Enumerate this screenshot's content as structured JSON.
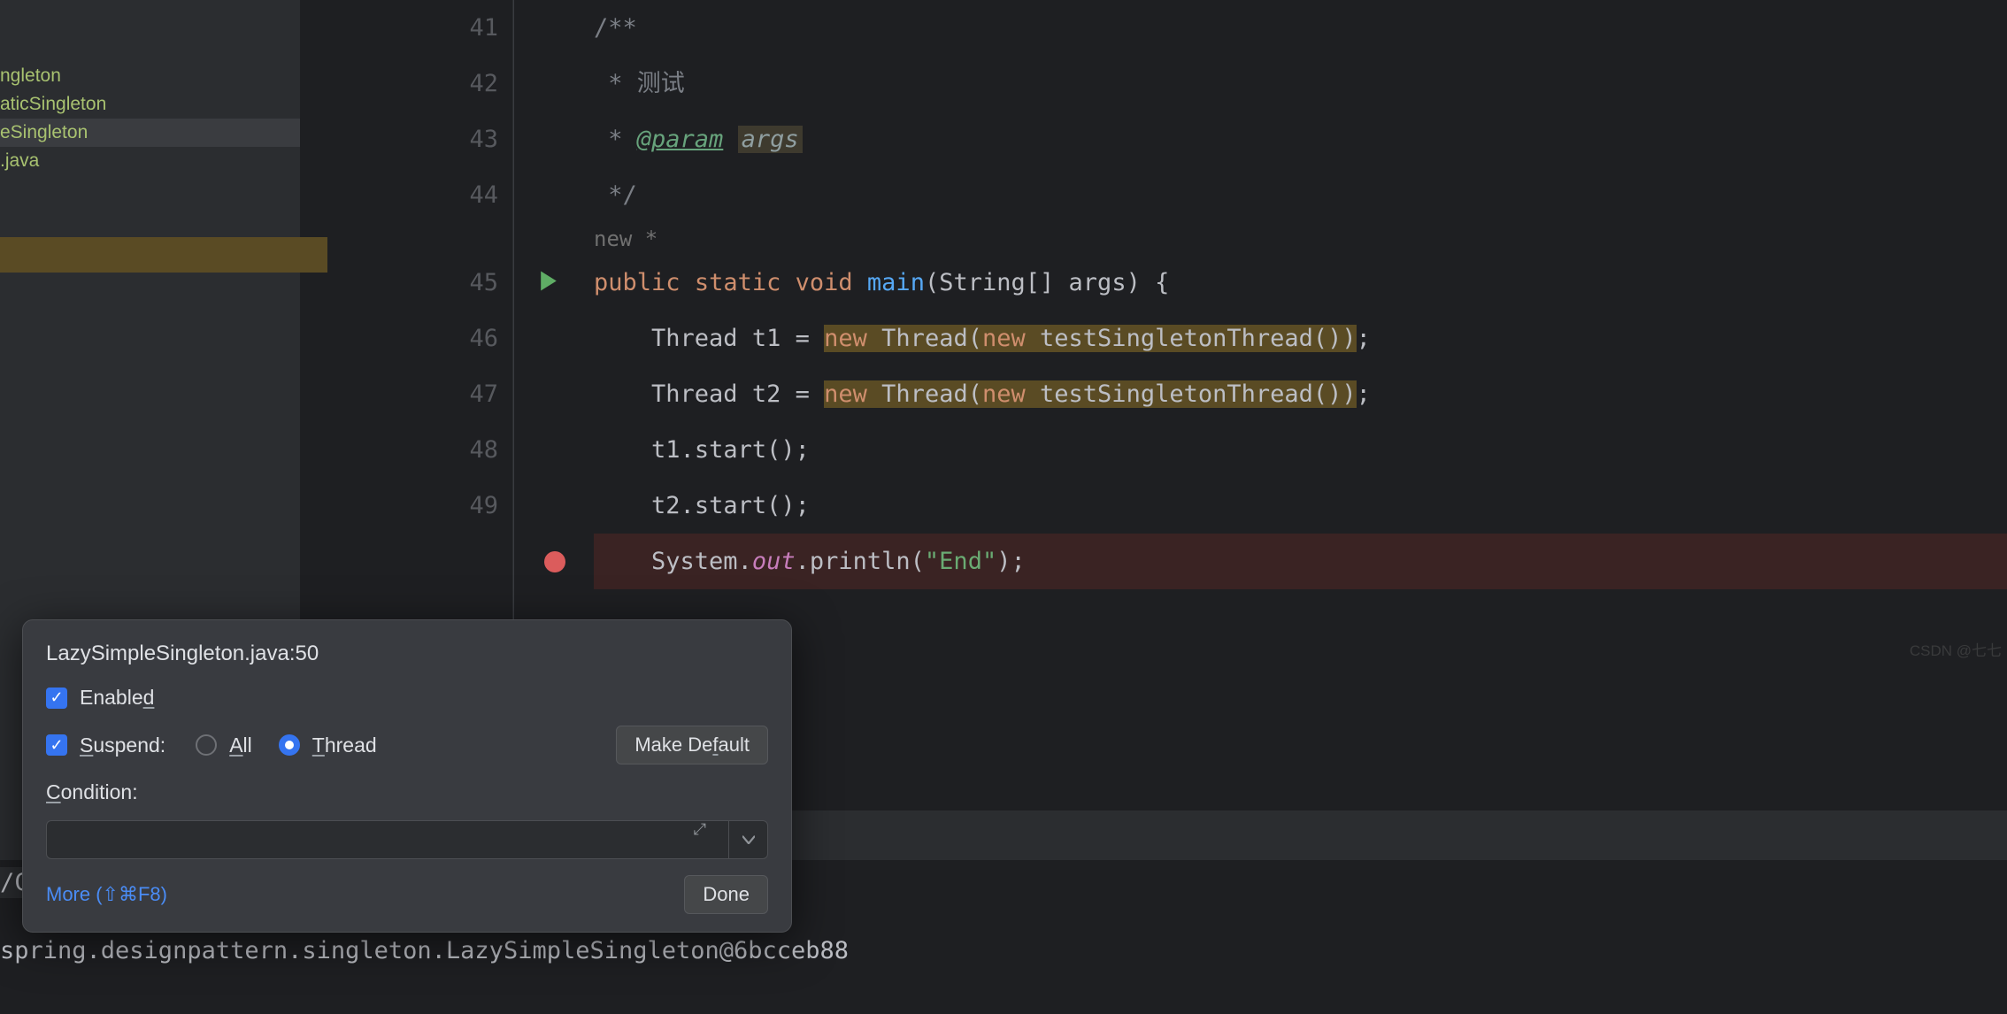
{
  "sidebar": {
    "items": [
      "ngleton",
      "aticSingleton",
      "eSingleton",
      ".java"
    ]
  },
  "gutter": {
    "lines": [
      "41",
      "42",
      "43",
      "44",
      "45",
      "46",
      "47",
      "48",
      "49",
      ""
    ]
  },
  "code": {
    "l41": "/**",
    "l42_a": " * ",
    "l42_b": "测试",
    "l43_a": " * ",
    "l43_b": "@param",
    "l43_c": "args",
    "l44": " */",
    "hint": "new *",
    "l45": {
      "kw1": "public",
      "kw2": "static",
      "kw3": "void",
      "fn": "main",
      "p1": "(",
      "ty": "String",
      "br": "[] ",
      "arg": "args",
      "p2": ") {"
    },
    "l46": {
      "ty": "Thread",
      "v": " t1 = ",
      "kw": "new",
      "sp": " ",
      "cls": "Thread",
      "p1": "(",
      "kw2": "new",
      "sp2": " ",
      "cls2": "testSingletonThread",
      "p2": "()",
      "p3": ")",
      "end": ";"
    },
    "l47": {
      "ty": "Thread",
      "v": " t2 = ",
      "kw": "new",
      "sp": " ",
      "cls": "Thread",
      "p1": "(",
      "kw2": "new",
      "sp2": " ",
      "cls2": "testSingletonThread",
      "p2": "()",
      "p3": ")",
      "end": ";"
    },
    "l48": {
      "v": "t1.",
      "m": "start",
      "p": "();"
    },
    "l49": {
      "v": "t2.",
      "m": "start",
      "p": "();"
    },
    "l50": {
      "sys": "System.",
      "out": "out",
      "m": ".println(",
      "str": "\"End\"",
      "p": ");"
    }
  },
  "console": {
    "path": "/Contents/Home/bin/java ...",
    "line": "spring.designpattern.singleton.LazySimpleSingleton@6bcceb88"
  },
  "popup": {
    "title": "LazySimpleSingleton.java:50",
    "enabled": "Enabled",
    "suspend": "Suspend:",
    "all": "All",
    "thread": "Thread",
    "make_default": "Make Default",
    "condition": "Condition:",
    "more": "More (⇧⌘F8)",
    "done": "Done"
  },
  "watermark": "CSDN @七七"
}
